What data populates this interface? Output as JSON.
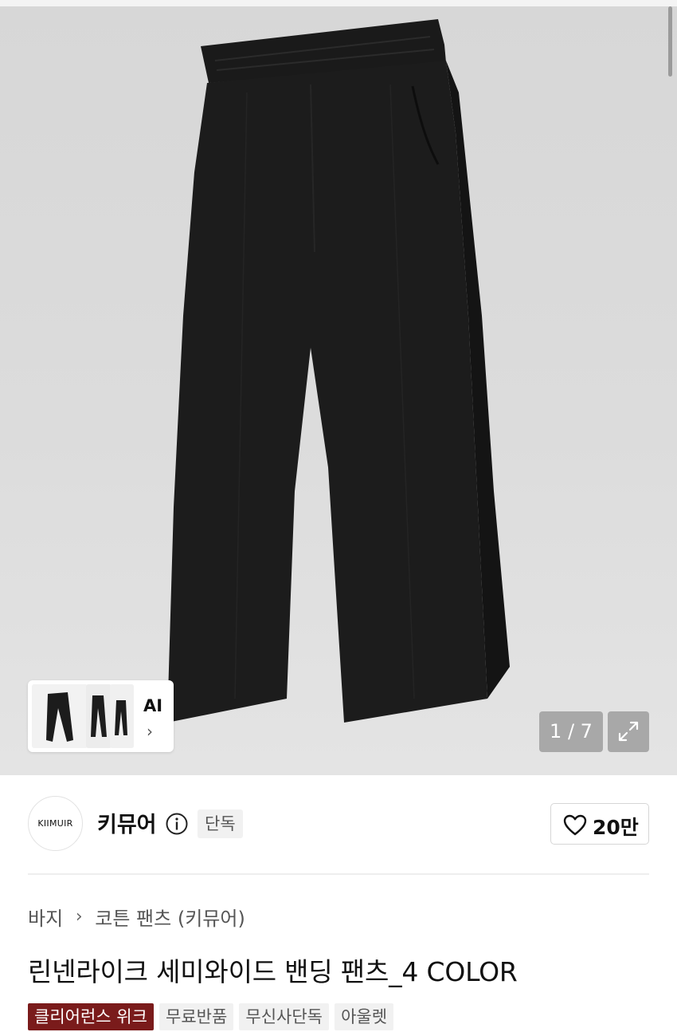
{
  "gallery": {
    "current": 1,
    "total": 7,
    "counter_text": "1 / 7",
    "expand_icon": "expand-icon"
  },
  "ai_card": {
    "label": "AI",
    "chevron": "›"
  },
  "brand": {
    "logo_text": "KIIMUIR",
    "name": "키뮤어",
    "exclusive_badge": "단독",
    "like_count": "20만"
  },
  "breadcrumb": {
    "category": "바지",
    "separator": "›",
    "subcategory": "코튼 팬츠 (키뮤어)"
  },
  "product": {
    "title": "린넨라이크 세미와이드 밴딩 팬츠_4 COLOR"
  },
  "tags": [
    {
      "label": "클리어런스 위크",
      "accent": true
    },
    {
      "label": "무료반품",
      "accent": false
    },
    {
      "label": "무신사단독",
      "accent": false
    },
    {
      "label": "아울렛",
      "accent": false
    }
  ],
  "colors": {
    "accent_tag": "#7a1b1b",
    "hero_bg": "#dcdcdc",
    "garment": "#1c1c1c"
  }
}
